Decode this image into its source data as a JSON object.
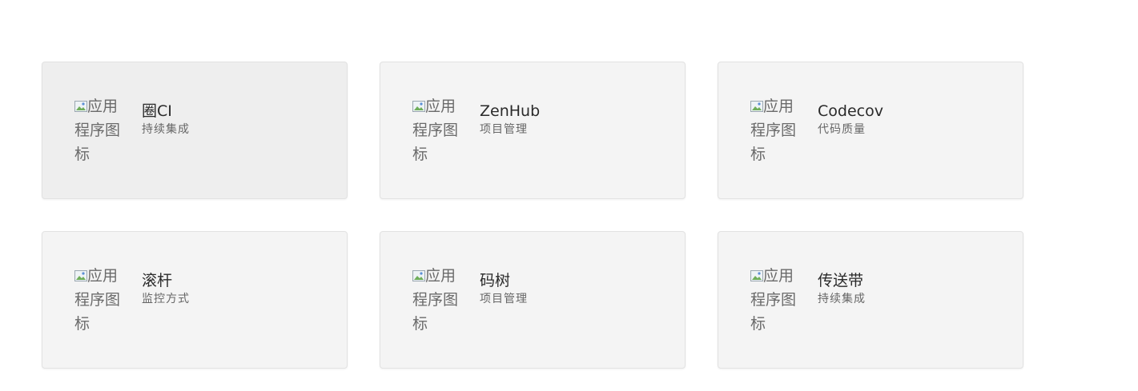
{
  "apps": [
    {
      "name": "圈CI",
      "category": "持续集成",
      "icon_alt": "应用程序图标",
      "icon": "broken-image-icon"
    },
    {
      "name": "ZenHub",
      "category": "项目管理",
      "icon_alt": "应用程序图标",
      "icon": "broken-image-icon"
    },
    {
      "name": "Codecov",
      "category": "代码质量",
      "icon_alt": "应用程序图标",
      "icon": "broken-image-icon"
    },
    {
      "name": "滚杆",
      "category": "监控方式",
      "icon_alt": "应用程序图标",
      "icon": "broken-image-icon"
    },
    {
      "name": "码树",
      "category": "项目管理",
      "icon_alt": "应用程序图标",
      "icon": "broken-image-icon"
    },
    {
      "name": "传送带",
      "category": "持续集成",
      "icon_alt": "应用程序图标",
      "icon": "broken-image-icon"
    }
  ],
  "colors": {
    "card_background": "#f4f4f4",
    "card_hover_background": "#eeeeee",
    "card_border": "#e2e2e2",
    "name_text": "#2a2a2a",
    "category_text": "#666666"
  }
}
